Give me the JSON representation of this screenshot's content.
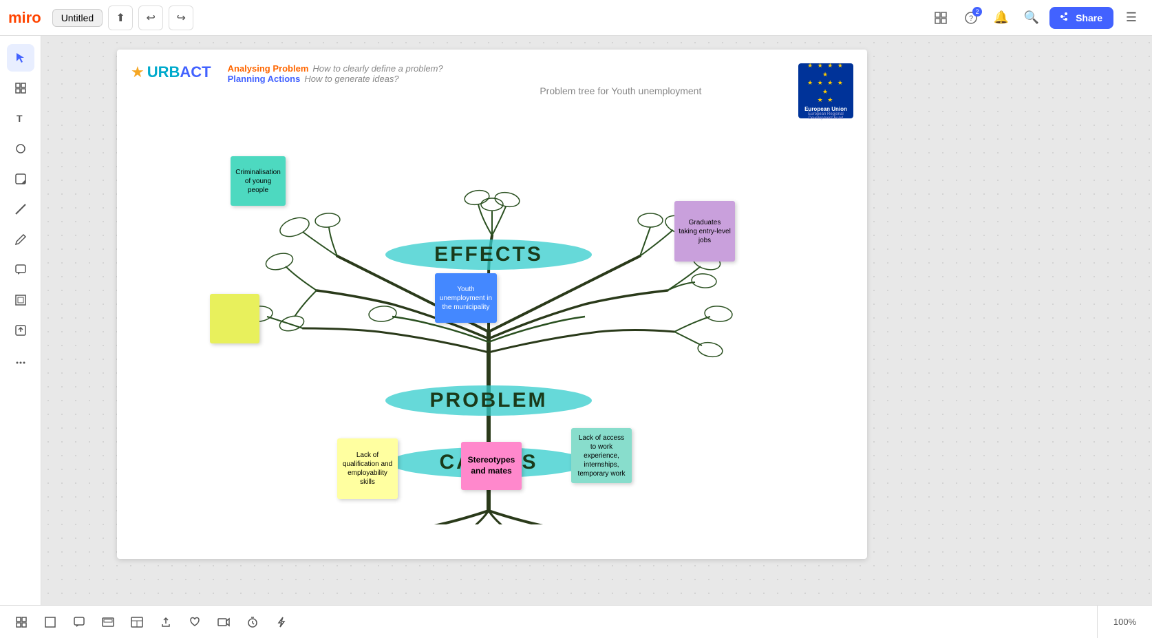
{
  "app": {
    "logo": "miro",
    "tab_title": "Untitled",
    "zoom": "100%"
  },
  "navbar": {
    "share_label": "Share",
    "undo_icon": "↩",
    "redo_icon": "↪",
    "export_icon": "⬆",
    "templates_icon": "⊞",
    "help_icon": "?",
    "notifications_icon": "🔔",
    "search_icon": "🔍",
    "menu_icon": "☰",
    "notification_count": "2"
  },
  "header": {
    "urbact_star": "★",
    "urbact_urb": "URB",
    "urbact_act": "ACT",
    "analysing_label": "Analysing Problem",
    "analysing_sub": "How to clearly define a problem?",
    "planning_label": "Planning Actions",
    "planning_sub": "How to generate ideas?",
    "problem_tree_title": "Problem tree for Youth unemployment",
    "eu_label": "European Union",
    "eu_sub": "European Regional Development Fund"
  },
  "tree": {
    "effects_label": "EFFECTS",
    "problem_label": "PROBLEM",
    "causes_label": "CAUSES"
  },
  "stickies": {
    "criminalisation": "Criminalisation of young people",
    "graduates": "Graduates taking entry-level jobs",
    "yellow": "",
    "qualification": "Lack of qualification and employability skills",
    "stereotypes": "Stereotypes and mates",
    "access": "Lack of access to work experience, internships, temporary work",
    "youth": "Youth unemployment in the municipality"
  },
  "toolbar": {
    "tools": [
      "cursor",
      "grid",
      "text",
      "circle",
      "sticky",
      "line",
      "pencil",
      "comment",
      "frame",
      "upload",
      "more"
    ]
  },
  "bottom_toolbar": {
    "icons": [
      "grid",
      "frame",
      "comment",
      "expand",
      "layout",
      "export",
      "like",
      "video",
      "timer",
      "bolt"
    ]
  }
}
